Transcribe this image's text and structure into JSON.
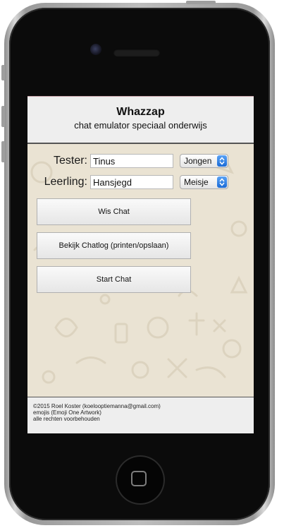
{
  "app": {
    "title": "Whazzap",
    "subtitle": "chat emulator speciaal onderwijs"
  },
  "form": {
    "tester_label": "Tester:",
    "tester_value": "Tinus",
    "tester_gender": "Jongen",
    "student_label": "Leerling:",
    "student_value": "Hansjegd",
    "student_gender": "Meisje"
  },
  "buttons": {
    "clear_chat": "Wis Chat",
    "view_log": "Bekijk Chatlog (printen/opslaan)",
    "start_chat": "Start Chat"
  },
  "footer": {
    "copyright": "©2015 Roel Koster (koelooptiemanna@gmail.com)",
    "emoji_credit": "emojis (Emoji One Artwork)",
    "rights": "alle rechten voorbehouden"
  },
  "colors": {
    "select_arrow_accent": "#1b6bd6",
    "screen_background": "#eae3d3"
  }
}
